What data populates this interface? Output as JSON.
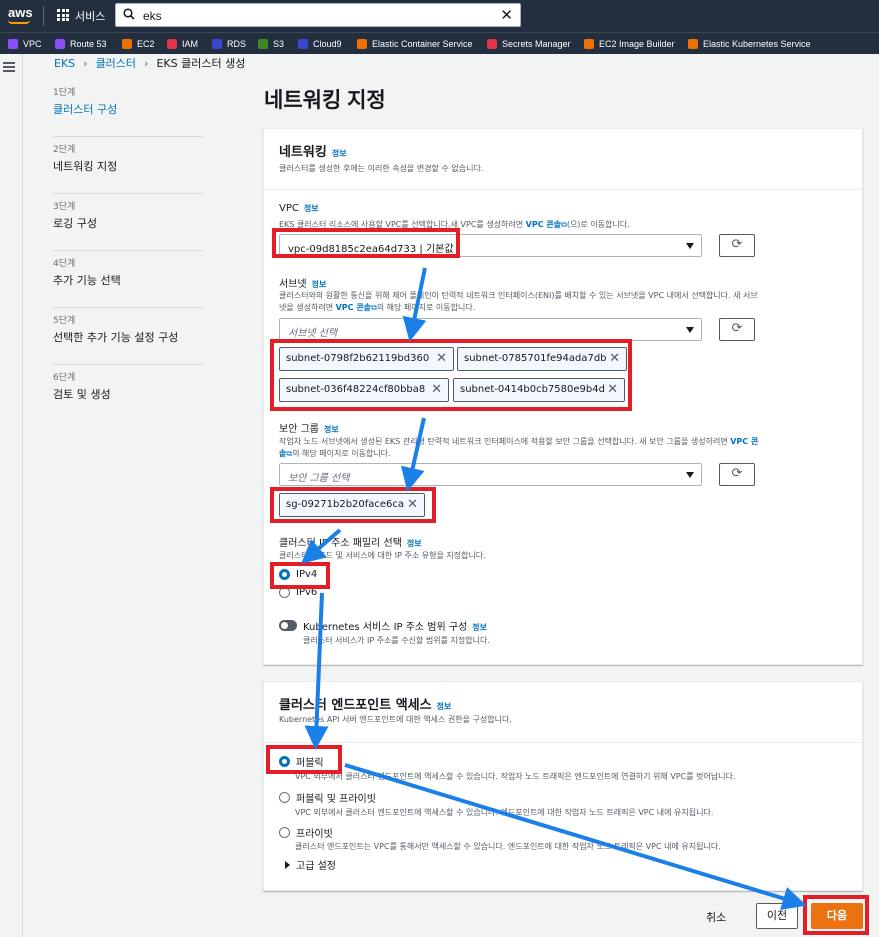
{
  "topnav": {
    "logo": "aws",
    "services": "서비스",
    "search_value": "eks"
  },
  "favorites": [
    {
      "label": "VPC",
      "color": "#8c4fff"
    },
    {
      "label": "Route 53",
      "color": "#8c4fff"
    },
    {
      "label": "EC2",
      "color": "#ed7100"
    },
    {
      "label": "IAM",
      "color": "#dd344c"
    },
    {
      "label": "RDS",
      "color": "#3b48cc"
    },
    {
      "label": "S3",
      "color": "#3f8624"
    },
    {
      "label": "Cloud9",
      "color": "#3b48cc"
    },
    {
      "label": "Elastic Container Service",
      "color": "#ed7100"
    },
    {
      "label": "Secrets Manager",
      "color": "#dd344c"
    },
    {
      "label": "EC2 Image Builder",
      "color": "#ed7100"
    },
    {
      "label": "Elastic Kubernetes Service",
      "color": "#ed7100"
    }
  ],
  "breadcrumb": [
    "EKS",
    "클러스터",
    "EKS 클러스터 생성"
  ],
  "steps": [
    {
      "no": "1단계",
      "name": "클러스터 구성"
    },
    {
      "no": "2단계",
      "name": "네트워킹 지정"
    },
    {
      "no": "3단계",
      "name": "로깅 구성"
    },
    {
      "no": "4단계",
      "name": "추가 기능 선택"
    },
    {
      "no": "5단계",
      "name": "선택한 추가 기능 설정 구성"
    },
    {
      "no": "6단계",
      "name": "검토 및 생성"
    }
  ],
  "page_title": "네트워킹 지정",
  "networking": {
    "title": "네트워킹",
    "info": "정보",
    "desc": "클러스터를 생성한 후에는 이러한 속성을 변경할 수 없습니다.",
    "vpc": {
      "label": "VPC",
      "info": "정보",
      "desc_a": "EKS 클러스터 리소스에 사용할 VPC를 선택합니다.새 VPC를 생성하려면 ",
      "desc_link": "VPC 콘솔",
      "desc_b": "(으)로 이동합니다.",
      "value": "vpc-09d8185c2ea64d733 | 기본값"
    },
    "subnets": {
      "label": "서브넷",
      "info": "정보",
      "desc_line1": "클러스터와의 원활한 통신을 위해 제어 플레인이 탄력적 네트워크 인터페이스(ENI)를 배치할 수 있는 서브넷을 VPC 내에서 선택합니다. 새 서브",
      "desc_line2a": "넷을 생성하려면 ",
      "desc_link": "VPC 콘솔",
      "desc_line2b": "의 해당 페이지로 이동합니다.",
      "placeholder": "서브넷 선택",
      "tokens": [
        "subnet-0798f2b62119bd360",
        "subnet-0785701fe94ada7db",
        "subnet-036f48224cf80bba8",
        "subnet-0414b0cb7580e9b4d"
      ]
    },
    "security_group": {
      "label": "보안 그룹",
      "info": "정보",
      "desc_line1": "작업자 노드 서브넷에서 생성된 EKS 관리형 탄력적 네트워크 인터페이스에 적용할 보안 그룹을 선택합니다. 새 보안 그룹을 생성하려면 ",
      "desc_link1": "VPC 콘",
      "desc_link2": "솔",
      "desc_line2": "의 해당 페이지로 이동합니다.",
      "placeholder": "보안 그룹 선택",
      "token": "sg-09271b2b20face6ca"
    },
    "ip_family": {
      "label": "클러스터 IP 주소 패밀리 선택",
      "info": "정보",
      "desc": "클러스터의 포드 및 서비스에 대한 IP 주소 유형을 지정합니다.",
      "options": [
        "IPv4",
        "IPv6"
      ]
    },
    "k8s_range": {
      "label": "Kubernetes 서비스 IP 주소 범위 구성",
      "info": "정보",
      "desc": "클러스터 서비스가 IP 주소를 수신할 범위를 지정합니다."
    }
  },
  "endpoint": {
    "title": "클러스터 엔드포인트 액세스",
    "info": "정보",
    "desc": "Kubernetes API 서버 엔드포인트에 대한 액세스 권한을 구성합니다.",
    "options": [
      {
        "label": "퍼블릭",
        "desc": "VPC 외부에서 클러스터 엔드포인트에 액세스할 수 있습니다. 작업자 노드 트래픽은 엔드포인트에 연결하기 위해 VPC를 벗어납니다."
      },
      {
        "label": "퍼블릭 및 프라이빗",
        "desc": "VPC 외부에서 클러스터 엔드포인트에 액세스할 수 있습니다. 엔드포인트에 대한 작업자 노드 트래픽은 VPC 내에 유지됩니다."
      },
      {
        "label": "프라이빗",
        "desc": "클러스터 엔드포인트는 VPC를 통해서만 액세스할 수 있습니다. 엔드포인트에 대한 작업자 노드 트래픽은 VPC 내에 유지됩니다."
      }
    ],
    "advanced": "고급 설정"
  },
  "footer": {
    "cancel": "취소",
    "previous": "이전",
    "next": "다음"
  },
  "colors": {
    "highlight": "#e41e26",
    "arrow": "#1a7fe6",
    "primary": "#ec7211",
    "link": "#0073bb"
  }
}
